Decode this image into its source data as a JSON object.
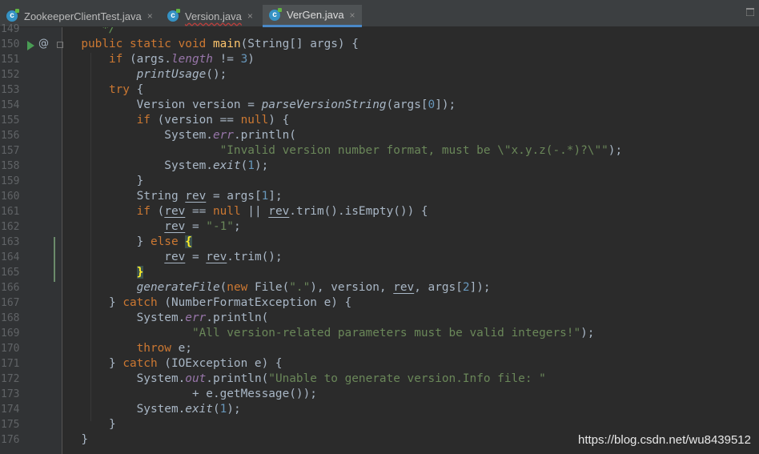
{
  "tabs": [
    {
      "label": "ZookeeperClientTest.java",
      "icon": "java-class-icon",
      "close": "×",
      "squiggle": false
    },
    {
      "label": "Version.java",
      "icon": "java-class-icon",
      "close": "×",
      "squiggle": true
    },
    {
      "label": "VerGen.java",
      "icon": "java-class-icon",
      "close": "×",
      "squiggle": false,
      "active": true
    }
  ],
  "line_numbers": [
    "149",
    "150",
    "151",
    "152",
    "153",
    "154",
    "155",
    "156",
    "157",
    "158",
    "159",
    "160",
    "161",
    "162",
    "163",
    "164",
    "165",
    "166",
    "167",
    "168",
    "169",
    "170",
    "171",
    "172",
    "173",
    "174",
    "175",
    "176"
  ],
  "gutter": {
    "run": "run-icon",
    "override": "@"
  },
  "code_lines": [
    [
      {
        "t": "     "
      },
      {
        "c": "cm",
        "t": "*/"
      }
    ],
    [
      {
        "t": "  "
      },
      {
        "c": "kw",
        "t": "public static void "
      },
      {
        "c": "fn",
        "t": "main"
      },
      {
        "t": "(String[] args) {"
      }
    ],
    [
      {
        "t": "      "
      },
      {
        "c": "kw",
        "t": "if "
      },
      {
        "t": "(args."
      },
      {
        "c": "fd",
        "t": "length"
      },
      {
        "t": " != "
      },
      {
        "c": "nm",
        "t": "3"
      },
      {
        "t": ")"
      }
    ],
    [
      {
        "t": "          "
      },
      {
        "c": "it",
        "t": "printUsage"
      },
      {
        "t": "();"
      }
    ],
    [
      {
        "t": "      "
      },
      {
        "c": "kw",
        "t": "try "
      },
      {
        "t": "{"
      }
    ],
    [
      {
        "t": "          Version version = "
      },
      {
        "c": "it",
        "t": "parseVersionString"
      },
      {
        "t": "(args["
      },
      {
        "c": "nm",
        "t": "0"
      },
      {
        "t": "]);"
      }
    ],
    [
      {
        "t": "          "
      },
      {
        "c": "kw",
        "t": "if "
      },
      {
        "t": "(version == "
      },
      {
        "c": "kw",
        "t": "null"
      },
      {
        "t": ") {"
      }
    ],
    [
      {
        "t": "              System."
      },
      {
        "c": "fd",
        "t": "err"
      },
      {
        "t": ".println("
      }
    ],
    [
      {
        "t": "                      "
      },
      {
        "c": "st",
        "t": "\"Invalid version number format, must be \\\"x.y.z(-.*)?\\\"\""
      },
      {
        "t": ");"
      }
    ],
    [
      {
        "t": "              System."
      },
      {
        "c": "it",
        "t": "exit"
      },
      {
        "t": "("
      },
      {
        "c": "nm",
        "t": "1"
      },
      {
        "t": ");"
      }
    ],
    [
      {
        "t": "          }"
      }
    ],
    [
      {
        "t": "          String "
      },
      {
        "c": "ul",
        "t": "rev"
      },
      {
        "t": " = args["
      },
      {
        "c": "nm",
        "t": "1"
      },
      {
        "t": "];"
      }
    ],
    [
      {
        "t": "          "
      },
      {
        "c": "kw",
        "t": "if "
      },
      {
        "t": "("
      },
      {
        "c": "ul",
        "t": "rev"
      },
      {
        "t": " == "
      },
      {
        "c": "kw",
        "t": "null "
      },
      {
        "t": "|| "
      },
      {
        "c": "ul",
        "t": "rev"
      },
      {
        "t": ".trim().isEmpty()) {"
      }
    ],
    [
      {
        "t": "              "
      },
      {
        "c": "ul",
        "t": "rev"
      },
      {
        "t": " = "
      },
      {
        "c": "st",
        "t": "\"-1\""
      },
      {
        "t": ";"
      }
    ],
    [
      {
        "t": "          } "
      },
      {
        "c": "kw",
        "t": "else "
      },
      {
        "c": "hl",
        "t": "{"
      }
    ],
    [
      {
        "t": "              "
      },
      {
        "c": "ul",
        "t": "rev"
      },
      {
        "t": " = "
      },
      {
        "c": "ul",
        "t": "rev"
      },
      {
        "t": ".trim();"
      }
    ],
    [
      {
        "t": "          "
      },
      {
        "c": "hl",
        "t": "}"
      }
    ],
    [
      {
        "t": "          "
      },
      {
        "c": "it",
        "t": "generateFile"
      },
      {
        "t": "("
      },
      {
        "c": "kw",
        "t": "new "
      },
      {
        "t": "File("
      },
      {
        "c": "st",
        "t": "\".\""
      },
      {
        "t": "), version, "
      },
      {
        "c": "ul",
        "t": "rev"
      },
      {
        "t": ", args["
      },
      {
        "c": "nm",
        "t": "2"
      },
      {
        "t": "]);"
      }
    ],
    [
      {
        "t": "      } "
      },
      {
        "c": "kw",
        "t": "catch "
      },
      {
        "t": "(NumberFormatException e) {"
      }
    ],
    [
      {
        "t": "          System."
      },
      {
        "c": "fd",
        "t": "err"
      },
      {
        "t": ".println("
      }
    ],
    [
      {
        "t": "                  "
      },
      {
        "c": "st",
        "t": "\"All version-related parameters must be valid integers!\""
      },
      {
        "t": ");"
      }
    ],
    [
      {
        "t": "          "
      },
      {
        "c": "kw",
        "t": "throw "
      },
      {
        "t": "e;"
      }
    ],
    [
      {
        "t": "      } "
      },
      {
        "c": "kw",
        "t": "catch "
      },
      {
        "t": "(IOException e) {"
      }
    ],
    [
      {
        "t": "          System."
      },
      {
        "c": "fd",
        "t": "out"
      },
      {
        "t": ".println("
      },
      {
        "c": "st",
        "t": "\"Unable to generate version.Info file: \""
      }
    ],
    [
      {
        "t": "                  + e.getMessage());"
      }
    ],
    [
      {
        "t": "          System."
      },
      {
        "c": "it",
        "t": "exit"
      },
      {
        "t": "("
      },
      {
        "c": "nm",
        "t": "1"
      },
      {
        "t": ");"
      }
    ],
    [
      {
        "t": "      }"
      }
    ],
    [
      {
        "t": "  }"
      }
    ]
  ],
  "watermark": "https://blog.csdn.net/wu8439512"
}
